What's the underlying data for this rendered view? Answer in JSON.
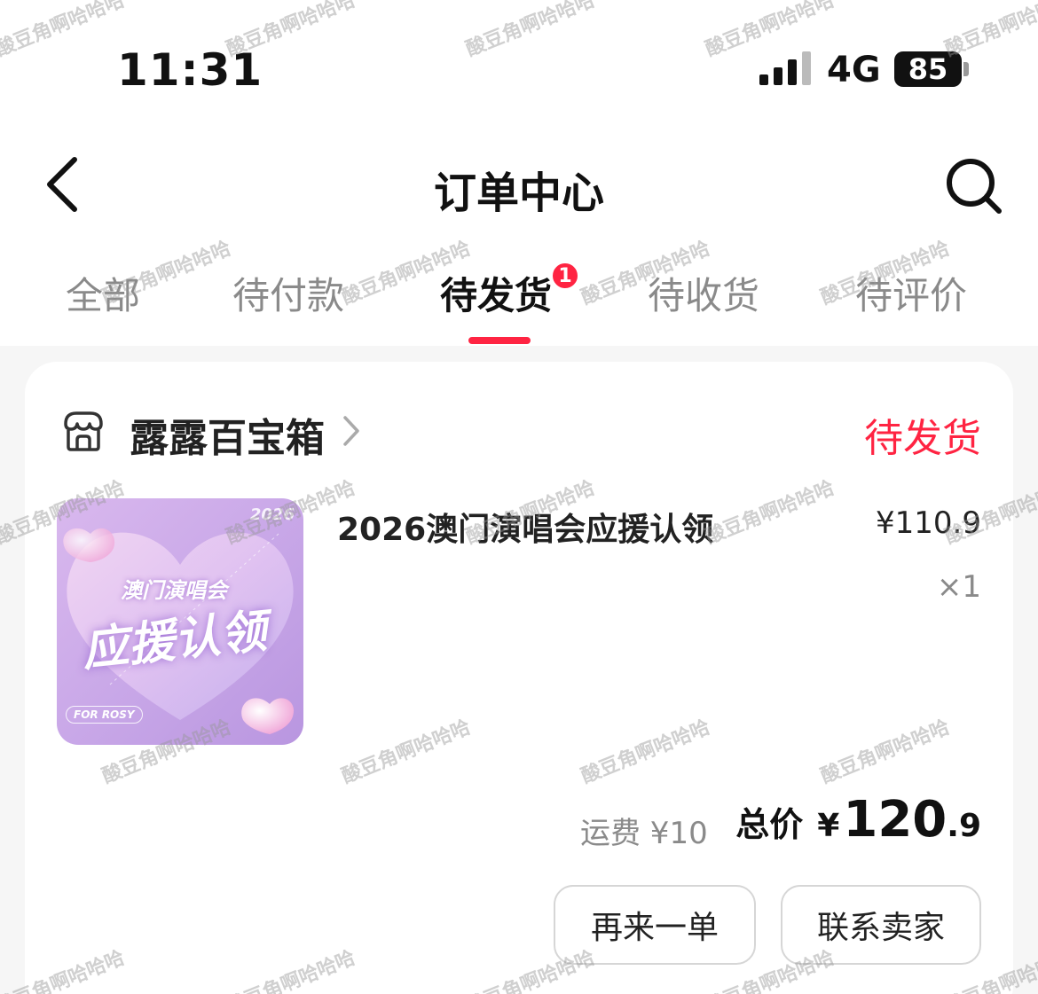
{
  "status_bar": {
    "time": "11:31",
    "network": "4G",
    "battery": "85"
  },
  "nav": {
    "back_icon": "chevron-left-icon",
    "title": "订单中心",
    "search_icon": "search-icon"
  },
  "tabs": {
    "items": [
      {
        "label": "全部",
        "active": false
      },
      {
        "label": "待付款",
        "active": false
      },
      {
        "label": "待发货",
        "active": true,
        "badge": "1"
      },
      {
        "label": "待收货",
        "active": false
      },
      {
        "label": "待评价",
        "active": false
      }
    ]
  },
  "order": {
    "shop_icon": "storefront-icon",
    "shop_name": "露露百宝箱",
    "status": "待发货",
    "product": {
      "name": "2026澳门演唱会应援认领",
      "price": "¥110.9",
      "quantity": "×1",
      "thumbnail": {
        "year": "2026",
        "line1": "澳门演唱会",
        "line2": "应援认领",
        "tag": "FOR ROSY"
      }
    },
    "shipping": "运费 ¥10",
    "total": {
      "label": "总价",
      "currency": "¥",
      "integer": "120",
      "decimal": ".9"
    },
    "actions": {
      "reorder": "再来一单",
      "contact": "联系卖家"
    }
  },
  "watermark": "酸豆角啊哈哈哈",
  "colors": {
    "accent": "#ff2442",
    "muted_text": "#8a8a8a",
    "page_bg": "#f6f6f6"
  }
}
